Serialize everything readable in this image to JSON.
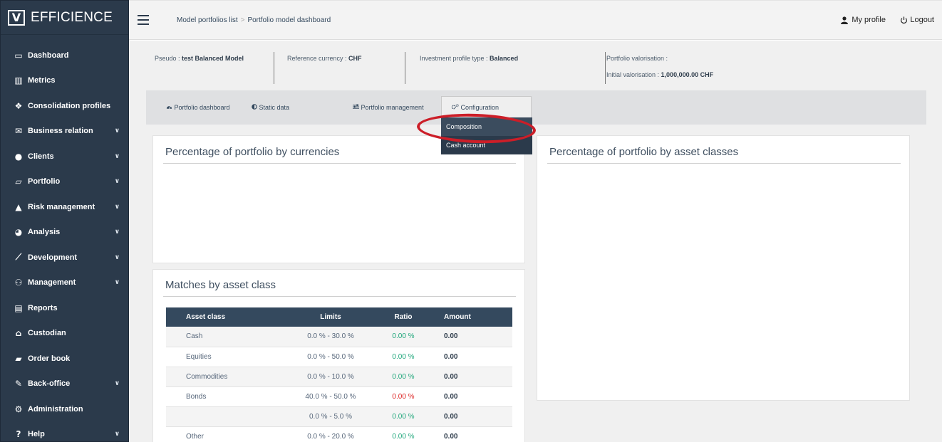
{
  "app": {
    "name": "EFFICIENCE",
    "logo_letter": "V"
  },
  "sidebar": {
    "items": [
      {
        "label": "Dashboard",
        "icon": "monitor-icon",
        "glyph": "▭",
        "expandable": false
      },
      {
        "label": "Metrics",
        "icon": "bar-chart-icon",
        "glyph": "▥",
        "expandable": false
      },
      {
        "label": "Consolidation profiles",
        "icon": "cubes-icon",
        "glyph": "❖",
        "expandable": false
      },
      {
        "label": "Business relation",
        "icon": "chat-icon",
        "glyph": "✉",
        "expandable": true
      },
      {
        "label": "Clients",
        "icon": "user-icon",
        "glyph": "●",
        "expandable": true
      },
      {
        "label": "Portfolio",
        "icon": "folder-icon",
        "glyph": "▱",
        "expandable": true
      },
      {
        "label": "Risk management",
        "icon": "warning-icon",
        "glyph": "▲",
        "expandable": true
      },
      {
        "label": "Analysis",
        "icon": "pie-chart-icon",
        "glyph": "◕",
        "expandable": true
      },
      {
        "label": "Development",
        "icon": "line-chart-icon",
        "glyph": "⟋",
        "expandable": true
      },
      {
        "label": "Management",
        "icon": "sitemap-icon",
        "glyph": "⚇",
        "expandable": true
      },
      {
        "label": "Reports",
        "icon": "file-icon",
        "glyph": "▤",
        "expandable": false
      },
      {
        "label": "Custodian",
        "icon": "bank-icon",
        "glyph": "⌂",
        "expandable": false
      },
      {
        "label": "Order book",
        "icon": "book-icon",
        "glyph": "▰",
        "expandable": false
      },
      {
        "label": "Back-office",
        "icon": "edit-icon",
        "glyph": "✎",
        "expandable": true
      },
      {
        "label": "Administration",
        "icon": "gear-icon",
        "glyph": "⚙",
        "expandable": false
      },
      {
        "label": "Help",
        "icon": "question-icon",
        "glyph": "?",
        "expandable": true
      }
    ]
  },
  "header": {
    "breadcrumb": [
      "Model portfolios list",
      "Portfolio model dashboard"
    ],
    "breadcrumb_sep": ">",
    "profile_label": "My profile",
    "logout_label": "Logout"
  },
  "info": {
    "pseudo_label": "Pseudo : ",
    "pseudo_value": "test Balanced Model",
    "currency_label": "Reference currency : ",
    "currency_value": "CHF",
    "profile_type_label": "Investment profile type : ",
    "profile_type_value": "Balanced",
    "valorisation_label": "Portfolio valorisation :",
    "initial_valorisation_label": "Initial valorisation : ",
    "initial_valorisation_value": "1,000,000.00 CHF"
  },
  "tabs": [
    {
      "label": "Portfolio dashboard",
      "icon": "tachometer-icon"
    },
    {
      "label": "Static data",
      "icon": "half-circle-icon"
    },
    {
      "label": "Portfolio management",
      "icon": "sliders-icon"
    },
    {
      "label": "Configuration",
      "icon": "gears-icon"
    }
  ],
  "dropdown": {
    "items": [
      "Composition",
      "Cash account"
    ],
    "selected": "Composition"
  },
  "panels": {
    "currencies_title": "Percentage of portfolio by currencies",
    "asset_classes_title": "Percentage of portfolio by asset classes",
    "matches_title": "Matches by asset class"
  },
  "matches_table": {
    "headers": [
      "Asset class",
      "Limits",
      "Ratio",
      "Amount"
    ],
    "rows": [
      {
        "asset_class": "Cash",
        "limits": "0.0 % - 30.0 %",
        "ratio": "0.00 %",
        "ratio_ok": true,
        "amount": "0.00"
      },
      {
        "asset_class": "Equities",
        "limits": "0.0 % - 50.0 %",
        "ratio": "0.00 %",
        "ratio_ok": true,
        "amount": "0.00"
      },
      {
        "asset_class": "Commodities",
        "limits": "0.0 % - 10.0 %",
        "ratio": "0.00 %",
        "ratio_ok": true,
        "amount": "0.00"
      },
      {
        "asset_class": "Bonds",
        "limits": "40.0 % - 50.0 %",
        "ratio": "0.00 %",
        "ratio_ok": false,
        "amount": "0.00"
      },
      {
        "asset_class": "",
        "limits": "0.0 % - 5.0 %",
        "ratio": "0.00 %",
        "ratio_ok": true,
        "amount": "0.00"
      },
      {
        "asset_class": "Other",
        "limits": "0.0 % - 20.0 %",
        "ratio": "0.00 %",
        "ratio_ok": true,
        "amount": "0.00"
      }
    ]
  },
  "colors": {
    "sidebar_bg": "#2b3a4b",
    "table_header_bg": "#34495e",
    "ratio_ok": "#1ea67a",
    "ratio_bad": "#dd2222",
    "highlight_ring": "#cc1e28"
  }
}
